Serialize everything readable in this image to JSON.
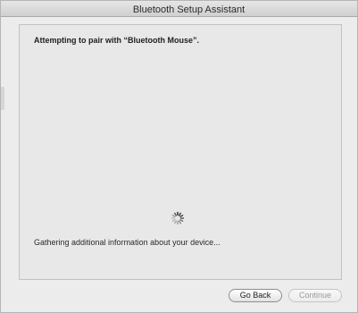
{
  "window": {
    "title": "Bluetooth Setup Assistant"
  },
  "panel": {
    "heading": "Attempting to pair with “Bluetooth Mouse”.",
    "status": "Gathering additional information about your device..."
  },
  "buttons": {
    "go_back": "Go Back",
    "continue": "Continue",
    "continue_enabled": false
  },
  "icons": {
    "spinner": "progress-spinner-icon"
  }
}
